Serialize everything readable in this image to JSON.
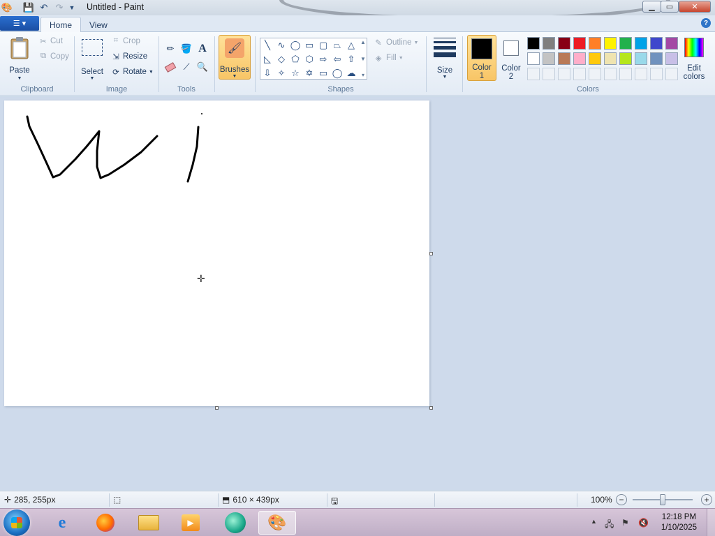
{
  "window": {
    "title": "Untitled - Paint",
    "tabs": [
      "Home",
      "View"
    ],
    "controls": {
      "minimize": "▁",
      "maximize": "▭",
      "close": "✕"
    }
  },
  "ribbon": {
    "clipboard": {
      "label": "Clipboard",
      "paste": "Paste",
      "cut": "Cut",
      "copy": "Copy"
    },
    "image": {
      "label": "Image",
      "select": "Select",
      "crop": "Crop",
      "resize": "Resize",
      "rotate": "Rotate"
    },
    "tools": {
      "label": "Tools"
    },
    "brushes": {
      "label": "Brushes"
    },
    "shapes": {
      "label": "Shapes",
      "outline": "Outline",
      "fill": "Fill"
    },
    "size": {
      "label": "Size"
    },
    "colors": {
      "label": "Colors",
      "color1": {
        "line1": "Color",
        "line2": "1",
        "value": "#000000"
      },
      "color2": {
        "line1": "Color",
        "line2": "2",
        "value": "#ffffff"
      },
      "edit_colors": {
        "line1": "Edit",
        "line2": "colors"
      },
      "palette_row1": [
        "#000000",
        "#7f7f7f",
        "#880015",
        "#ed1c24",
        "#ff7f27",
        "#fff200",
        "#22b14c",
        "#00a2e8",
        "#3f48cc",
        "#a349a4"
      ],
      "palette_row2": [
        "#ffffff",
        "#c3c3c3",
        "#b97a57",
        "#ffaec9",
        "#ffc90e",
        "#efe4b0",
        "#b5e61d",
        "#99d9ea",
        "#7092be",
        "#c8bfe7"
      ]
    }
  },
  "status": {
    "cursor_pos": "285, 255px",
    "selection_size": "",
    "canvas_size": "610 × 439px",
    "zoom": "100%",
    "zoom_level": 0.5
  },
  "taskbar": {
    "time": "12:18 PM",
    "date": "1/10/2025"
  }
}
